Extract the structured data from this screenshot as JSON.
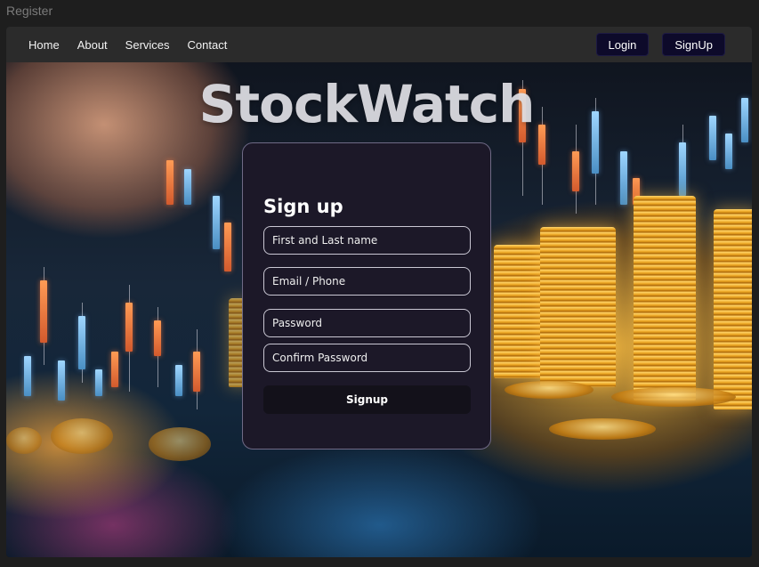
{
  "window": {
    "title": "Register"
  },
  "nav": {
    "links": [
      {
        "label": "Home"
      },
      {
        "label": "About"
      },
      {
        "label": "Services"
      },
      {
        "label": "Contact"
      }
    ],
    "login_label": "Login",
    "signup_label": "SignUp"
  },
  "hero": {
    "brand": "StockWatch"
  },
  "form": {
    "title": "Sign up",
    "name_placeholder": "First and Last name",
    "email_placeholder": "Email / Phone",
    "password_placeholder": "Password",
    "confirm_placeholder": "Confirm Password",
    "submit_label": "Signup"
  },
  "colors": {
    "nav_background": "#2b2b2b",
    "button_background": "#0d0a2a",
    "card_background": "#1c1828",
    "card_border": "#6f6a86"
  }
}
